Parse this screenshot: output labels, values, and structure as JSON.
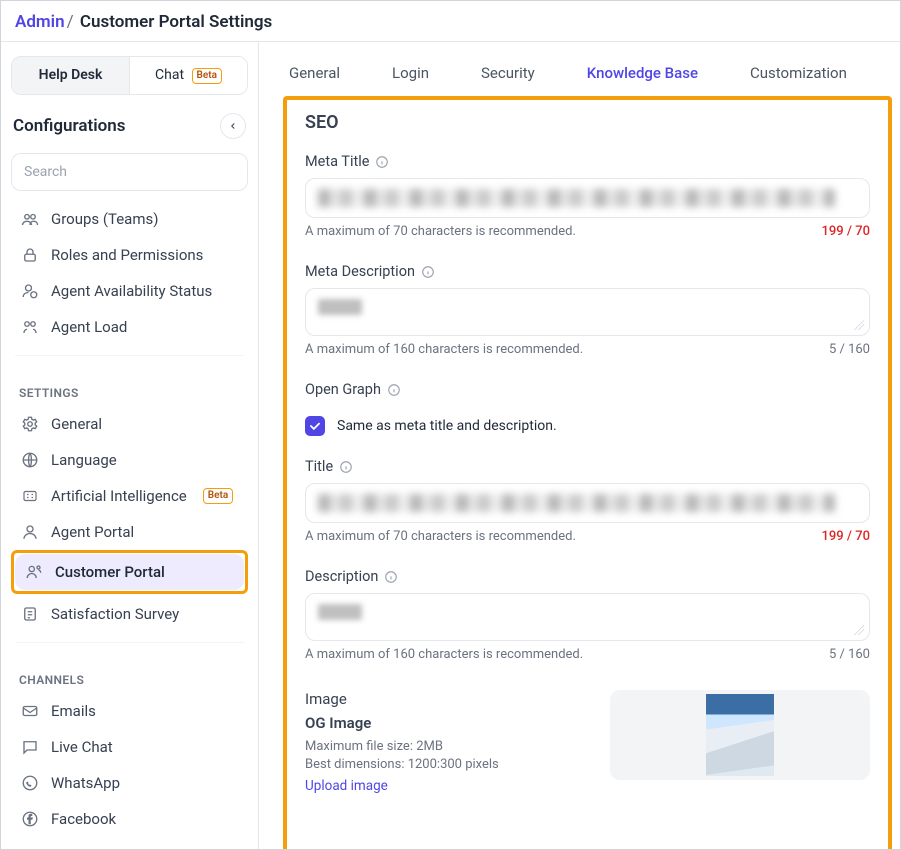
{
  "breadcrumb": {
    "admin": "Admin",
    "page": "Customer Portal Settings"
  },
  "sidebar": {
    "seg": {
      "help_desk": "Help Desk",
      "chat": "Chat",
      "chat_badge": "Beta"
    },
    "configurations_title": "Configurations",
    "search_placeholder": "Search",
    "top_items": [
      {
        "label": "Groups (Teams)"
      },
      {
        "label": "Roles and Permissions"
      },
      {
        "label": "Agent Availability Status"
      },
      {
        "label": "Agent Load"
      }
    ],
    "settings_heading": "SETTINGS",
    "settings_items": [
      {
        "label": "General"
      },
      {
        "label": "Language"
      },
      {
        "label": "Artificial Intelligence",
        "badge": "Beta"
      },
      {
        "label": "Agent Portal"
      },
      {
        "label": "Customer Portal"
      },
      {
        "label": "Satisfaction Survey"
      }
    ],
    "channels_heading": "CHANNELS",
    "channels_items": [
      {
        "label": "Emails"
      },
      {
        "label": "Live Chat"
      },
      {
        "label": "WhatsApp"
      },
      {
        "label": "Facebook"
      }
    ]
  },
  "tabs": [
    "General",
    "Login",
    "Security",
    "Knowledge Base",
    "Customization"
  ],
  "active_tab": "Knowledge Base",
  "seo": {
    "section_title": "SEO",
    "meta_title_label": "Meta Title",
    "meta_title_hint": "A maximum of 70 characters is recommended.",
    "meta_title_count": "199 / 70",
    "meta_desc_label": "Meta Description",
    "meta_desc_hint": "A maximum of 160 characters is recommended.",
    "meta_desc_count": "5 / 160",
    "open_graph_label": "Open Graph",
    "same_as_label": "Same as meta title and description.",
    "title_label": "Title",
    "title_hint": "A maximum of 70 characters is recommended.",
    "title_count": "199 / 70",
    "desc_label": "Description",
    "desc_hint": "A maximum of 160 characters is recommended.",
    "desc_count": "5 / 160",
    "image_heading": "Image",
    "og_image_heading": "OG Image",
    "image_hint1": "Maximum file size: 2MB",
    "image_hint2": "Best dimensions: 1200:300 pixels",
    "upload_label": "Upload image"
  }
}
